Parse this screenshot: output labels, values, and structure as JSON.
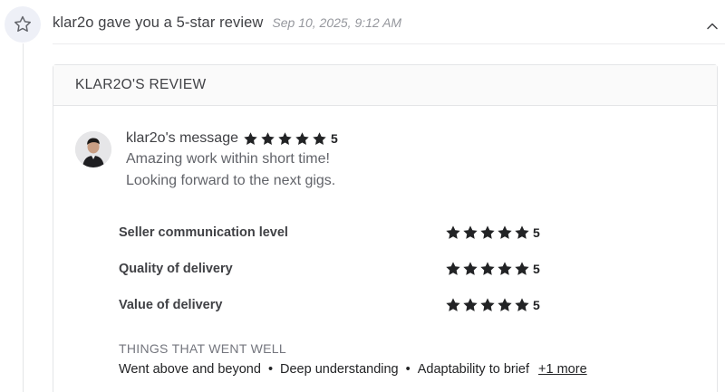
{
  "event": {
    "title": "klar2o gave you a 5-star review",
    "timestamp": "Sep 10, 2025, 9:12 AM",
    "icon": "star-outline-icon",
    "collapse_icon": "chevron-up-icon"
  },
  "review": {
    "header_title": "KLAR2O'S REVIEW",
    "author_label": "klar2o's message",
    "overall_rating": "5",
    "message_lines": [
      "Amazing work within short time!",
      "Looking forward to the next gigs."
    ],
    "ratings": [
      {
        "label": "Seller communication level",
        "value": "5"
      },
      {
        "label": "Quality of delivery",
        "value": "5"
      },
      {
        "label": "Value of delivery",
        "value": "5"
      }
    ],
    "went_well": {
      "title": "THINGS THAT WENT WELL",
      "items": [
        "Went above and beyond",
        "Deep understanding",
        "Adaptability to brief"
      ],
      "more_label": "+1 more"
    }
  },
  "colors": {
    "star": "#222325",
    "icon_bg": "#eef0f7",
    "icon_stroke": "#62646a",
    "card_header_bg": "#fafafa"
  }
}
